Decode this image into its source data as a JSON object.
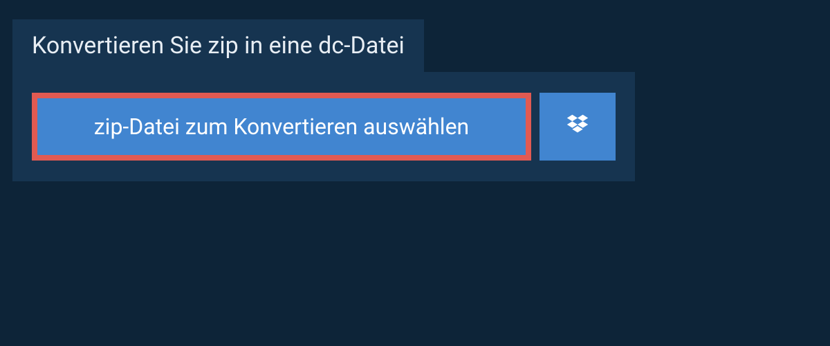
{
  "header": {
    "title": "Konvertieren Sie zip in eine dc-Datei"
  },
  "actions": {
    "select_file_label": "zip-Datei zum Konvertieren auswählen",
    "dropbox_icon_name": "dropbox"
  },
  "colors": {
    "background": "#0d2438",
    "panel": "#163450",
    "button": "#4185d0",
    "button_highlight_border": "#e15a52",
    "text_light": "#ffffff"
  }
}
